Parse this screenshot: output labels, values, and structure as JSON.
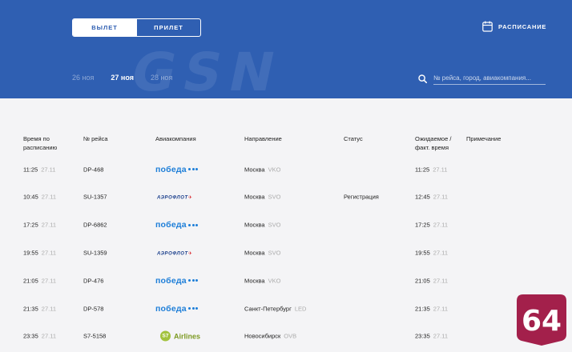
{
  "header": {
    "toggle": {
      "departure": "ВЫЛЕТ",
      "arrival": "ПРИЛЕТ"
    },
    "schedule_link": "РАСПИСАНИЕ",
    "watermark": "GSN",
    "dates": [
      "26 ноя",
      "27 ноя",
      "28 ноя"
    ],
    "search": {
      "placeholder": "№ рейса, город, авиакомпания..."
    }
  },
  "table": {
    "columns": {
      "time": [
        "Время по",
        "расписанию"
      ],
      "flight": "№ рейса",
      "airline": "Авиакомпания",
      "direction": "Направление",
      "status": "Статус",
      "expected": [
        "Ожидаемое /",
        "факт. время"
      ],
      "note": "Примечание"
    },
    "rows": [
      {
        "time": "11:25",
        "date": "27.11",
        "flight": "DP-468",
        "airline": "pobeda",
        "city": "Москва",
        "airport": "VKO",
        "status": "",
        "expected_time": "11:25",
        "expected_date": "27.11",
        "note": ""
      },
      {
        "time": "10:45",
        "date": "27.11",
        "flight": "SU-1357",
        "airline": "aeroflot",
        "city": "Москва",
        "airport": "SVO",
        "status": "Регистрация",
        "expected_time": "12:45",
        "expected_date": "27.11",
        "note": ""
      },
      {
        "time": "17:25",
        "date": "27.11",
        "flight": "DP-6862",
        "airline": "pobeda",
        "city": "Москва",
        "airport": "SVO",
        "status": "",
        "expected_time": "17:25",
        "expected_date": "27.11",
        "note": ""
      },
      {
        "time": "19:55",
        "date": "27.11",
        "flight": "SU-1359",
        "airline": "aeroflot",
        "city": "Москва",
        "airport": "SVO",
        "status": "",
        "expected_time": "19:55",
        "expected_date": "27.11",
        "note": ""
      },
      {
        "time": "21:05",
        "date": "27.11",
        "flight": "DP-476",
        "airline": "pobeda",
        "city": "Москва",
        "airport": "VKO",
        "status": "",
        "expected_time": "21:05",
        "expected_date": "27.11",
        "note": ""
      },
      {
        "time": "21:35",
        "date": "27.11",
        "flight": "DP-578",
        "airline": "pobeda",
        "city": "Санкт-Петербург",
        "airport": "LED",
        "status": "",
        "expected_time": "21:35",
        "expected_date": "27.11",
        "note": ""
      },
      {
        "time": "23:35",
        "date": "27.11",
        "flight": "S7-5158",
        "airline": "s7",
        "city": "Новосибирск",
        "airport": "OVB",
        "status": "",
        "expected_time": "23:35",
        "expected_date": "27.11",
        "note": ""
      }
    ]
  },
  "logos": {
    "pobeda": "победа",
    "aeroflot": "АЭРОФЛОТ",
    "s7_mark": "S7",
    "s7_text": "Airlines"
  },
  "badge": "64",
  "colors": {
    "header_bg": "#2f5fb2",
    "badge_bg": "#a3204b",
    "pobeda_blue": "#1d7ed8",
    "aeroflot_navy": "#1b3f8c",
    "aeroflot_red": "#d8232a",
    "s7_green": "#a2c23d"
  },
  "icons": {
    "schedule": "calendar-icon",
    "search": "search-icon"
  }
}
